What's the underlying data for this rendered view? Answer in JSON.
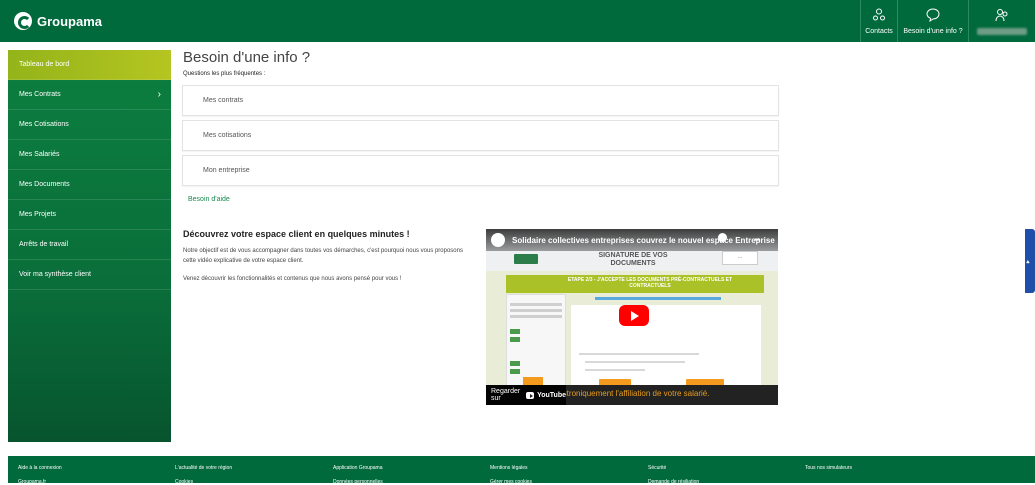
{
  "header": {
    "brand": "Groupama",
    "contacts_label": "Contacts",
    "info_label": "Besoin d'une info ?"
  },
  "sidebar": {
    "items": [
      {
        "label": "Tableau de bord",
        "active": true
      },
      {
        "label": "Mes Contrats"
      },
      {
        "label": "Mes Cotisations"
      },
      {
        "label": "Mes Salariés"
      },
      {
        "label": "Mes Documents"
      },
      {
        "label": "Mes Projets"
      },
      {
        "label": "Arrêts de travail"
      },
      {
        "label": "Voir ma synthèse client"
      }
    ]
  },
  "main": {
    "title": "Besoin d'une info ?",
    "faq_subtitle": "Questions les plus fréquentes :",
    "faq": [
      "Mes contrats",
      "Mes cotisations",
      "Mon entreprise"
    ],
    "help_link": "Besoin d'aide",
    "discover_title": "Découvrez votre espace client en quelques minutes !",
    "discover_p1": "Notre objectif est de vous accompagner dans toutes vos démarches, c'est pourquoi nous vous proposons cette vidéo explicative de votre espace client.",
    "discover_p2": "Venez découvrir les fonctionnalités et contenus que nous avons pensé pour vous !"
  },
  "video": {
    "title": "Solidaire collectives entreprises couvrez le nouvel espace Entreprise",
    "heading": "SIGNATURE DE VOS DOCUMENTS",
    "step": "ETAPE 2/3 - J'ACCEPTE LES DOCUMENTS PRÉ-CONTRACTUELS ET CONTRACTUELS",
    "caption": "électroniquement l'affiliation de votre salarié.",
    "watch_on": "Regarder sur",
    "platform": "YouTube"
  },
  "footer": {
    "row1": [
      "Aide à la connexion",
      "L'actualité de votre région",
      "Application Groupama",
      "Mentions légales",
      "Sécurité",
      "Tous nos simulateurs"
    ],
    "row2": [
      "Groupama.fr",
      "Cookies",
      "Données personnelles",
      "Gérer mes cookies",
      "Demande de résiliation",
      ""
    ]
  },
  "colors": {
    "brand_green": "#006a3d",
    "active_nav": "#aac128",
    "link_green": "#1b8a4c"
  }
}
